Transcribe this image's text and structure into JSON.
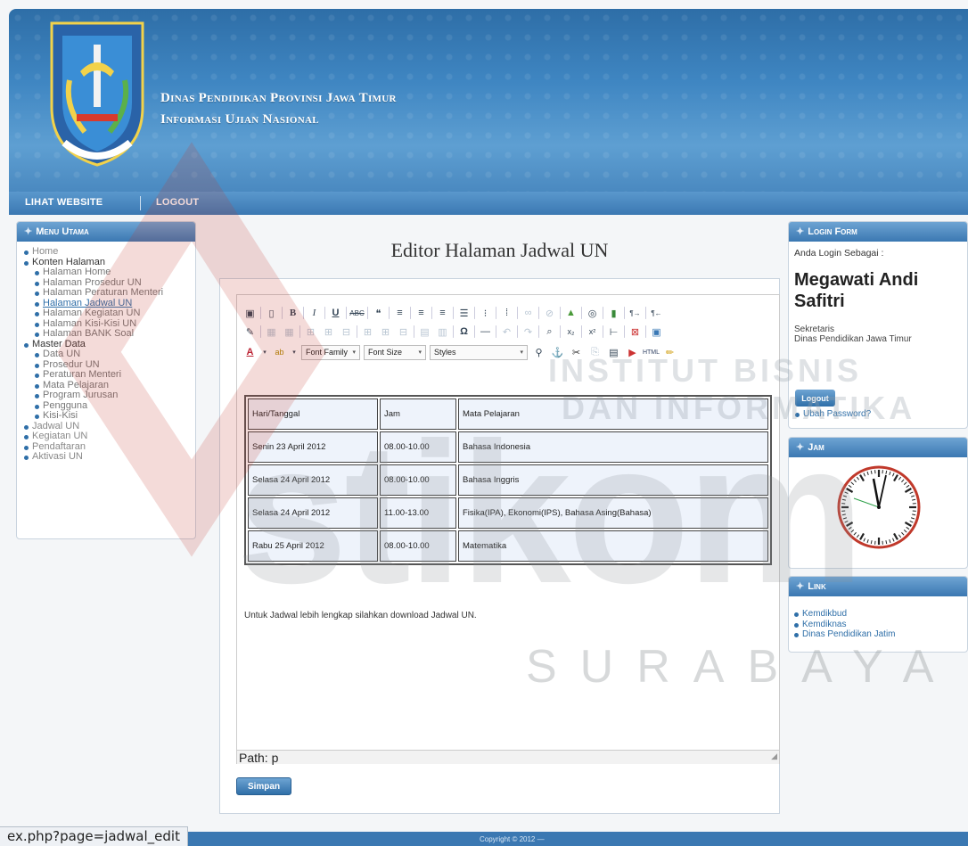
{
  "header": {
    "title_line1": "Dinas Pendidikan Provinsi Jawa Timur",
    "title_line2": "Informasi Ujian Nasional"
  },
  "topnav": {
    "items": [
      {
        "label": "LIHAT WEBSITE"
      },
      {
        "label": "LOGOUT"
      }
    ]
  },
  "left_menu": {
    "title": "Menu Utama",
    "items": [
      {
        "label": "Home"
      },
      {
        "label": "Konten Halaman"
      },
      {
        "label": "Halaman Home"
      },
      {
        "label": "Halaman Prosedur UN"
      },
      {
        "label": "Halaman Peraturan Menteri"
      },
      {
        "label": "Halaman Jadwal UN"
      },
      {
        "label": "Halaman Kegiatan UN"
      },
      {
        "label": "Halaman Kisi-Kisi UN"
      },
      {
        "label": "Halaman BANK Soal"
      },
      {
        "label": "Master Data"
      },
      {
        "label": "Data UN"
      },
      {
        "label": "Prosedur UN"
      },
      {
        "label": "Peraturan Menteri"
      },
      {
        "label": "Mata Pelajaran"
      },
      {
        "label": "Program Jurusan"
      },
      {
        "label": "Pengguna"
      },
      {
        "label": "Kisi-Kisi"
      },
      {
        "label": "Jadwal UN"
      },
      {
        "label": "Kegiatan UN"
      },
      {
        "label": "Pendaftaran"
      },
      {
        "label": "Aktivasi UN"
      }
    ]
  },
  "main": {
    "title": "Editor Halaman Jadwal UN",
    "toolbar": {
      "font_family": "Font Family",
      "font_size": "Font Size",
      "styles": "Styles"
    },
    "table": [
      [
        "Hari/Tanggal",
        "Jam",
        "Mata Pelajaran"
      ],
      [
        "Senin 23 April 2012",
        "08.00-10.00",
        "Bahasa Indonesia"
      ],
      [
        "Selasa 24 April 2012",
        "08.00-10.00",
        "Bahasa Inggris"
      ],
      [
        "Selasa 24 April 2012",
        "11.00-13.00",
        "Fisika(IPA), Ekonomi(IPS), Bahasa Asing(Bahasa)"
      ],
      [
        "Rabu 25 April 2012",
        "08.00-10.00",
        "Matematika"
      ]
    ],
    "note": "Untuk Jadwal lebih lengkap silahkan download Jadwal UN.",
    "path": "Path: p",
    "save_label": "Simpan"
  },
  "login": {
    "title": "Login Form",
    "label": "Anda Login Sebagai :",
    "name": "Megawati Andi Safitri",
    "role": "Sekretaris",
    "office": "Dinas Pendidikan Jawa Timur",
    "logout_label": "Logout",
    "password_link": "Ubah Password?"
  },
  "clock": {
    "title": "Jam"
  },
  "links": {
    "title": "Link",
    "items": [
      {
        "label": "Kemdikbud"
      },
      {
        "label": "Kemdiknas"
      },
      {
        "label": "Dinas Pendidikan Jatim"
      }
    ]
  },
  "footer": {
    "copyright": "Copyright © 2012 —"
  },
  "statusbar": {
    "url": "ex.php?page=jadwal_edit"
  },
  "watermark": {
    "line1": "INSTITUT BISNIS",
    "line2": "DAN INFORMATIKA",
    "brand": "stikom",
    "city": "SURABAYA"
  },
  "colors": {
    "header_blue": "#3f86c2",
    "accent": "#2f6fa8",
    "watermark_red": "#c0392b"
  }
}
